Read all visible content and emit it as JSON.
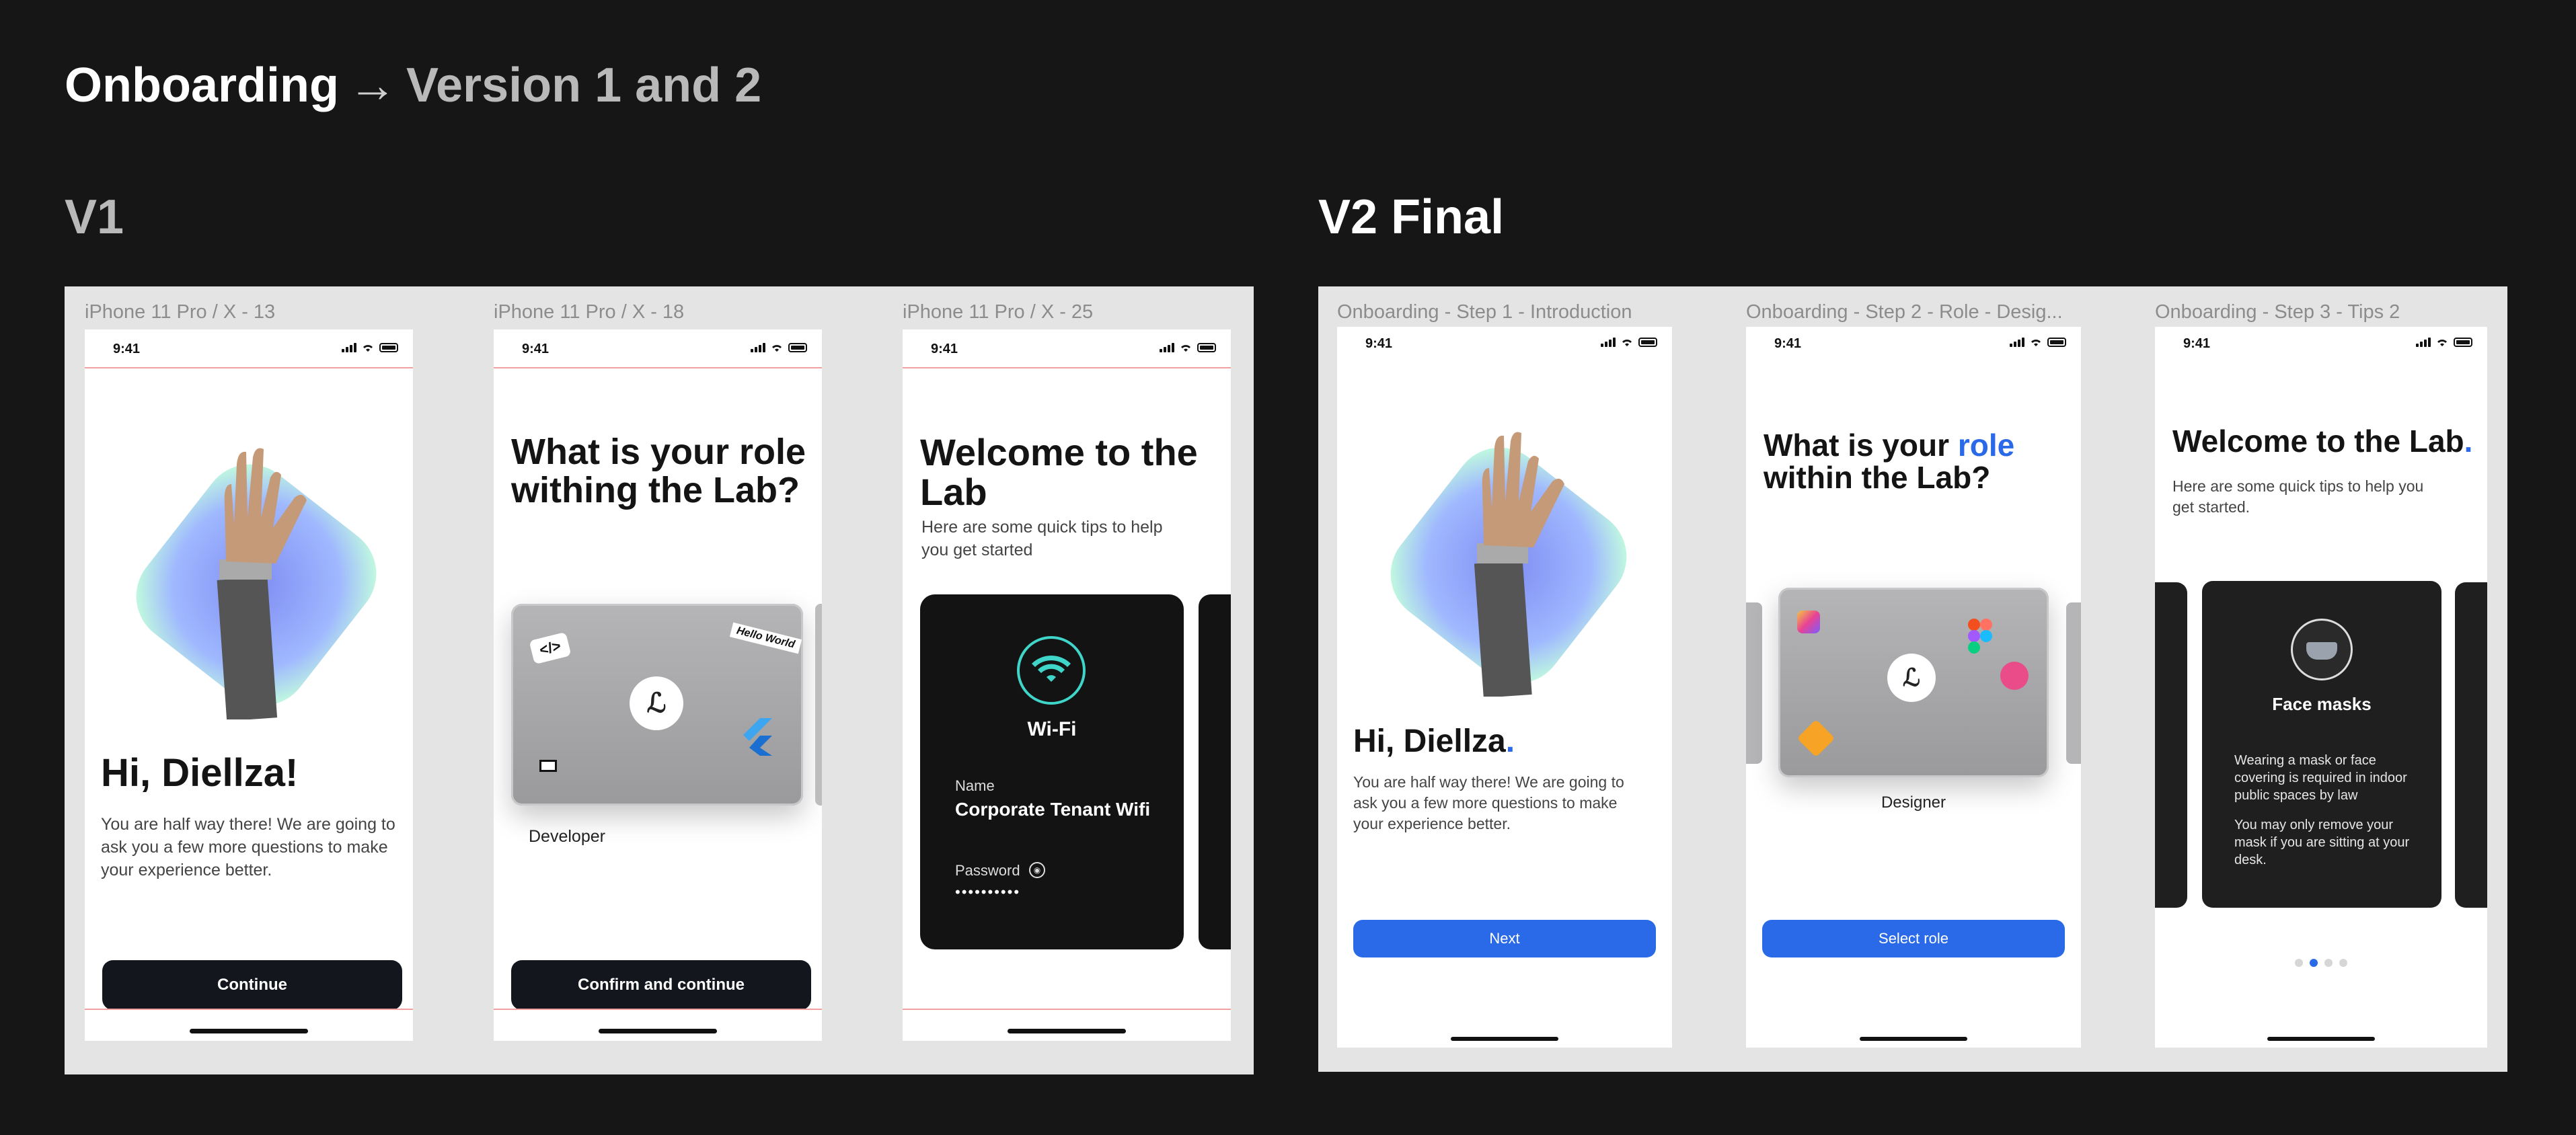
{
  "header": {
    "title_main": "Onboarding",
    "arrow": "→",
    "title_sub": "Version 1 and 2"
  },
  "sections": {
    "v1": "V1",
    "v2": "V2 Final"
  },
  "status_time": "9:41",
  "v1": {
    "frames": [
      {
        "label": "iPhone 11 Pro / X - 13",
        "heading": "Hi, Diellza!",
        "body": "You are half way there! We are going to ask you a few more questions to make your experience better.",
        "button": "Continue"
      },
      {
        "label": "iPhone 11 Pro / X - 18",
        "heading": "What is your role withing the Lab?",
        "sticker": "Hello World",
        "role": "Developer",
        "button": "Confirm and continue"
      },
      {
        "label": "iPhone 11 Pro / X - 25",
        "heading": "Welcome to the Lab",
        "body": "Here are some quick tips to help you get started",
        "card_title": "Wi-Fi",
        "name_label": "Name",
        "name_value": "Corporate Tenant Wifi",
        "password_label": "Password",
        "password_value": "••••••••••"
      }
    ]
  },
  "v2": {
    "frames": [
      {
        "label": "Onboarding - Step 1 - Introduction",
        "heading": "Hi, Diellza",
        "dot": ".",
        "body": "You are half way there! We are going  to ask you a few more questions to make your experience better.",
        "button": "Next"
      },
      {
        "label": "Onboarding - Step 2 - Role - Desig...",
        "heading_a": "What is your ",
        "heading_b": "role",
        "heading_c": " within the Lab?",
        "role": "Designer",
        "button": "Select role"
      },
      {
        "label": "Onboarding - Step 3 - Tips 2",
        "heading": "Welcome to the Lab",
        "dot": ".",
        "body": "Here are some quick tips to help you get started.",
        "card_title": "Face masks",
        "card_text_1": "Wearing a mask or face covering is required in indoor public spaces by law",
        "card_text_2": "You may only remove your mask if you are sitting at your desk.",
        "pager": {
          "total": 4,
          "active": 2
        }
      }
    ]
  },
  "colors": {
    "bg": "#161616",
    "panel": "#e4e4e4",
    "accent": "#2a6ae8",
    "teal": "#3fd6c9"
  }
}
